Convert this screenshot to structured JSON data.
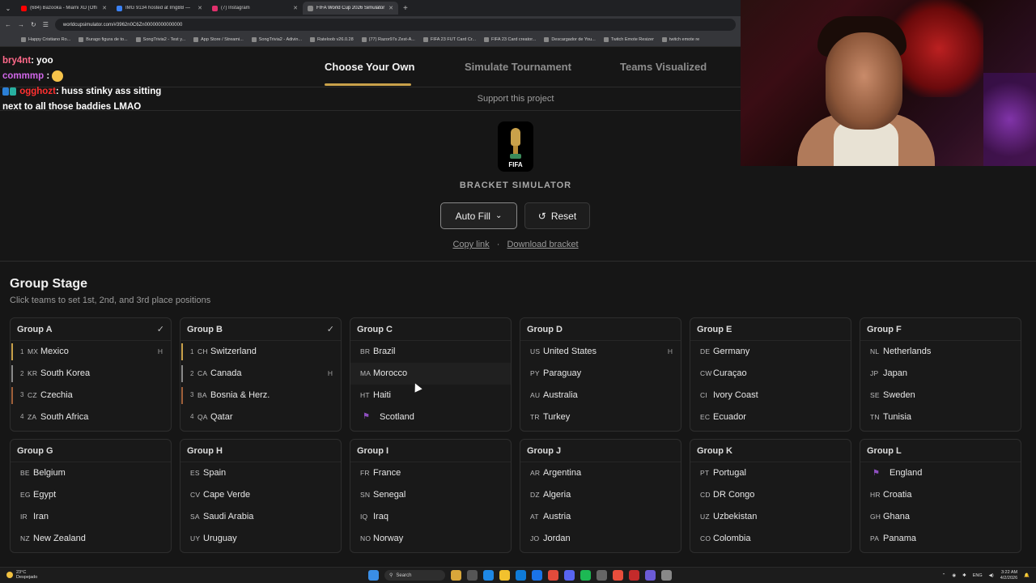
{
  "browser": {
    "tabs": [
      {
        "title": "(684) Bazooka - Miami XD [Offi",
        "color": "#ff0000"
      },
      {
        "title": "IMG 9134 hosted at ImgBB —",
        "color": "#3b82f6"
      },
      {
        "title": "(7) Instagram",
        "color": "#e1306c"
      },
      {
        "title": "FIFA World Cup 2026 Simulator",
        "color": "#888888"
      }
    ],
    "url": "worldcupsimulator.com/#3962n0C6Zn00000000000000",
    "bookmarks": [
      "Happy Cristiano Ro...",
      "Burago figura de to...",
      "SongTrivia2 - Test y...",
      "App Store / Streami...",
      "SongTrivia2 - Adivin...",
      "Rateloob v26.0.28",
      "(77) Razor97s Zest-A...",
      "FIFA 23 FUT Card Cr...",
      "FIFA 23 Card creator...",
      "Descargador de You...",
      "Twitch Emote Resizer",
      "twitch emote re"
    ]
  },
  "nav": {
    "tab_choose": "Choose Your Own",
    "tab_simulate": "Simulate Tournament",
    "tab_teams": "Teams Visualized"
  },
  "support_text": "Support this project",
  "logo_text": "FIFA",
  "bracket_title": "BRACKET SIMULATOR",
  "buttons": {
    "autofill": "Auto Fill",
    "autofill_icon": "⌄",
    "reset": "Reset",
    "reset_icon": "↺"
  },
  "links": {
    "copy": "Copy link",
    "sep": "·",
    "download": "Download bracket"
  },
  "group_stage": {
    "title": "Group Stage",
    "subtitle": "Click teams to set 1st, 2nd, and 3rd place positions"
  },
  "groups": [
    {
      "name": "Group A",
      "check": "✓",
      "teams": [
        {
          "pos": "1",
          "code": "MX",
          "name": "Mexico",
          "host": "H"
        },
        {
          "pos": "2",
          "code": "KR",
          "name": "South Korea",
          "host": ""
        },
        {
          "pos": "3",
          "code": "CZ",
          "name": "Czechia",
          "host": ""
        },
        {
          "pos": "4",
          "code": "ZA",
          "name": "South Africa",
          "host": ""
        }
      ]
    },
    {
      "name": "Group B",
      "check": "✓",
      "teams": [
        {
          "pos": "1",
          "code": "CH",
          "name": "Switzerland",
          "host": ""
        },
        {
          "pos": "2",
          "code": "CA",
          "name": "Canada",
          "host": "H"
        },
        {
          "pos": "3",
          "code": "BA",
          "name": "Bosnia & Herz.",
          "host": ""
        },
        {
          "pos": "4",
          "code": "QA",
          "name": "Qatar",
          "host": ""
        }
      ]
    },
    {
      "name": "Group C",
      "check": "",
      "teams": [
        {
          "pos": "",
          "code": "BR",
          "name": "Brazil",
          "host": ""
        },
        {
          "pos": "",
          "code": "MA",
          "name": "Morocco",
          "host": ""
        },
        {
          "pos": "",
          "code": "HT",
          "name": "Haiti",
          "host": ""
        },
        {
          "pos": "",
          "code": "",
          "name": "Scotland",
          "host": ""
        }
      ]
    },
    {
      "name": "Group D",
      "check": "",
      "teams": [
        {
          "pos": "",
          "code": "US",
          "name": "United States",
          "host": "H"
        },
        {
          "pos": "",
          "code": "PY",
          "name": "Paraguay",
          "host": ""
        },
        {
          "pos": "",
          "code": "AU",
          "name": "Australia",
          "host": ""
        },
        {
          "pos": "",
          "code": "TR",
          "name": "Turkey",
          "host": ""
        }
      ]
    },
    {
      "name": "Group E",
      "check": "",
      "teams": [
        {
          "pos": "",
          "code": "DE",
          "name": "Germany",
          "host": ""
        },
        {
          "pos": "",
          "code": "CW",
          "name": "Curaçao",
          "host": ""
        },
        {
          "pos": "",
          "code": "CI",
          "name": "Ivory Coast",
          "host": ""
        },
        {
          "pos": "",
          "code": "EC",
          "name": "Ecuador",
          "host": ""
        }
      ]
    },
    {
      "name": "Group F",
      "check": "",
      "teams": [
        {
          "pos": "",
          "code": "NL",
          "name": "Netherlands",
          "host": ""
        },
        {
          "pos": "",
          "code": "JP",
          "name": "Japan",
          "host": ""
        },
        {
          "pos": "",
          "code": "SE",
          "name": "Sweden",
          "host": ""
        },
        {
          "pos": "",
          "code": "TN",
          "name": "Tunisia",
          "host": ""
        }
      ]
    },
    {
      "name": "Group G",
      "check": "",
      "teams": [
        {
          "pos": "",
          "code": "BE",
          "name": "Belgium",
          "host": ""
        },
        {
          "pos": "",
          "code": "EG",
          "name": "Egypt",
          "host": ""
        },
        {
          "pos": "",
          "code": "IR",
          "name": "Iran",
          "host": ""
        },
        {
          "pos": "",
          "code": "NZ",
          "name": "New Zealand",
          "host": ""
        }
      ]
    },
    {
      "name": "Group H",
      "check": "",
      "teams": [
        {
          "pos": "",
          "code": "ES",
          "name": "Spain",
          "host": ""
        },
        {
          "pos": "",
          "code": "CV",
          "name": "Cape Verde",
          "host": ""
        },
        {
          "pos": "",
          "code": "SA",
          "name": "Saudi Arabia",
          "host": ""
        },
        {
          "pos": "",
          "code": "UY",
          "name": "Uruguay",
          "host": ""
        }
      ]
    },
    {
      "name": "Group I",
      "check": "",
      "teams": [
        {
          "pos": "",
          "code": "FR",
          "name": "France",
          "host": ""
        },
        {
          "pos": "",
          "code": "SN",
          "name": "Senegal",
          "host": ""
        },
        {
          "pos": "",
          "code": "IQ",
          "name": "Iraq",
          "host": ""
        },
        {
          "pos": "",
          "code": "NO",
          "name": "Norway",
          "host": ""
        }
      ]
    },
    {
      "name": "Group J",
      "check": "",
      "teams": [
        {
          "pos": "",
          "code": "AR",
          "name": "Argentina",
          "host": ""
        },
        {
          "pos": "",
          "code": "DZ",
          "name": "Algeria",
          "host": ""
        },
        {
          "pos": "",
          "code": "AT",
          "name": "Austria",
          "host": ""
        },
        {
          "pos": "",
          "code": "JO",
          "name": "Jordan",
          "host": ""
        }
      ]
    },
    {
      "name": "Group K",
      "check": "",
      "teams": [
        {
          "pos": "",
          "code": "PT",
          "name": "Portugal",
          "host": ""
        },
        {
          "pos": "",
          "code": "CD",
          "name": "DR Congo",
          "host": ""
        },
        {
          "pos": "",
          "code": "UZ",
          "name": "Uzbekistan",
          "host": ""
        },
        {
          "pos": "",
          "code": "CO",
          "name": "Colombia",
          "host": ""
        }
      ]
    },
    {
      "name": "Group L",
      "check": "",
      "teams": [
        {
          "pos": "",
          "code": "",
          "name": "England",
          "host": ""
        },
        {
          "pos": "",
          "code": "HR",
          "name": "Croatia",
          "host": ""
        },
        {
          "pos": "",
          "code": "GH",
          "name": "Ghana",
          "host": ""
        },
        {
          "pos": "",
          "code": "PA",
          "name": "Panama",
          "host": ""
        }
      ]
    }
  ],
  "chat": {
    "msg1_user": "bry4nt",
    "msg1_text": ": yoo",
    "msg2_user": "commmp",
    "msg2_text": " :",
    "msg3_user": "ogghozt",
    "msg3_text": ": huss stinky ass sitting next to all those baddies LMAO"
  },
  "taskbar": {
    "temp": "23°C",
    "weather": "Despejado",
    "search": "Search",
    "lang": "ENG",
    "time": "3:22 AM",
    "date": "4/2/2026"
  },
  "colors": {
    "accent_gold": "#c9a14a",
    "first_place": "#c9a14a",
    "second_place": "#8a8a8a",
    "third_place": "#a0603a"
  }
}
